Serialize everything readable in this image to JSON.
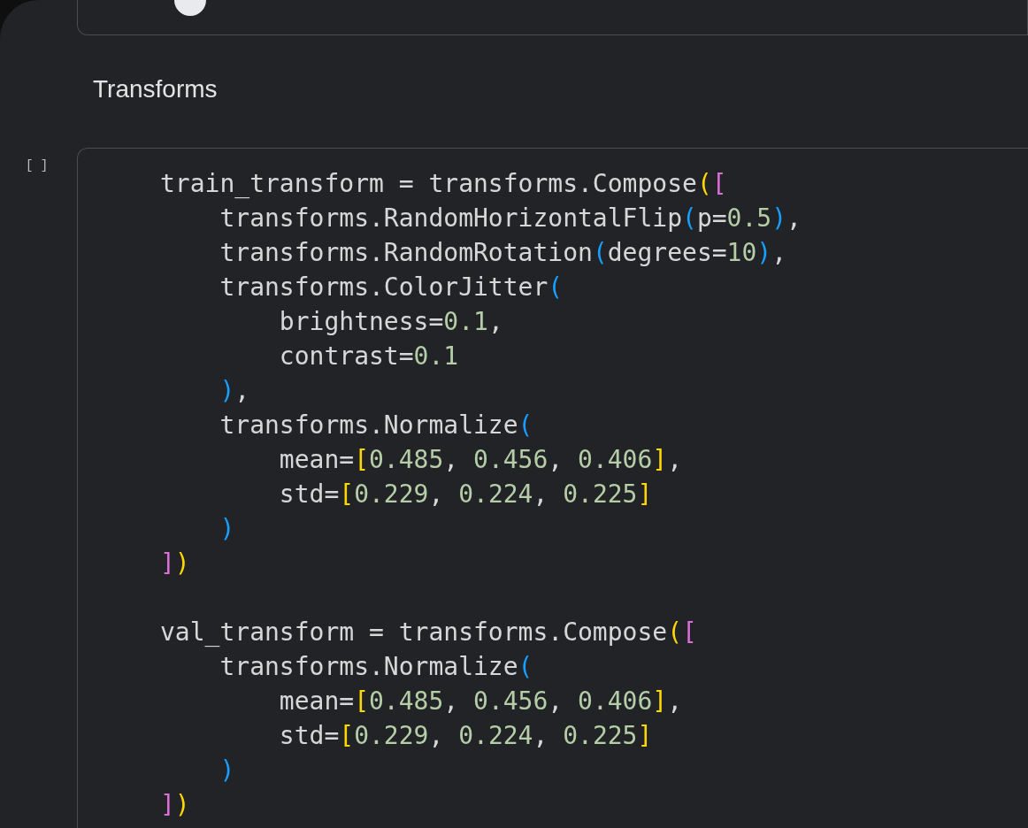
{
  "text_cell": {
    "heading": "Transforms"
  },
  "code_cell": {
    "execution_count": "[ ]",
    "statements": [
      [
        [
          {
            "kind": "plain",
            "text": "train_transform = transforms.Compose"
          },
          {
            "kind": "gold",
            "text": "("
          },
          {
            "kind": "pink",
            "text": "["
          }
        ],
        [
          {
            "kind": "plain",
            "text": "    transforms.RandomHorizontalFlip"
          },
          {
            "kind": "blue",
            "text": "("
          },
          {
            "kind": "plain",
            "text": "p="
          },
          {
            "kind": "number",
            "text": "0.5"
          },
          {
            "kind": "blue",
            "text": ")"
          },
          {
            "kind": "plain",
            "text": ","
          }
        ],
        [
          {
            "kind": "plain",
            "text": "    transforms.RandomRotation"
          },
          {
            "kind": "blue",
            "text": "("
          },
          {
            "kind": "plain",
            "text": "degrees="
          },
          {
            "kind": "number",
            "text": "10"
          },
          {
            "kind": "blue",
            "text": ")"
          },
          {
            "kind": "plain",
            "text": ","
          }
        ],
        [
          {
            "kind": "plain",
            "text": "    transforms.ColorJitter"
          },
          {
            "kind": "blue",
            "text": "("
          }
        ],
        [
          {
            "kind": "plain",
            "text": "        brightness="
          },
          {
            "kind": "number",
            "text": "0.1"
          },
          {
            "kind": "plain",
            "text": ","
          }
        ],
        [
          {
            "kind": "plain",
            "text": "        contrast="
          },
          {
            "kind": "number",
            "text": "0.1"
          }
        ],
        [
          {
            "kind": "blue",
            "text": "    )"
          },
          {
            "kind": "plain",
            "text": ","
          }
        ],
        [
          {
            "kind": "plain",
            "text": "    transforms.Normalize"
          },
          {
            "kind": "blue",
            "text": "("
          }
        ],
        [
          {
            "kind": "plain",
            "text": "        mean="
          },
          {
            "kind": "gold",
            "text": "["
          },
          {
            "kind": "number",
            "text": "0.485"
          },
          {
            "kind": "plain",
            "text": ", "
          },
          {
            "kind": "number",
            "text": "0.456"
          },
          {
            "kind": "plain",
            "text": ", "
          },
          {
            "kind": "number",
            "text": "0.406"
          },
          {
            "kind": "gold",
            "text": "]"
          },
          {
            "kind": "plain",
            "text": ","
          }
        ],
        [
          {
            "kind": "plain",
            "text": "        std="
          },
          {
            "kind": "gold",
            "text": "["
          },
          {
            "kind": "number",
            "text": "0.229"
          },
          {
            "kind": "plain",
            "text": ", "
          },
          {
            "kind": "number",
            "text": "0.224"
          },
          {
            "kind": "plain",
            "text": ", "
          },
          {
            "kind": "number",
            "text": "0.225"
          },
          {
            "kind": "gold",
            "text": "]"
          }
        ],
        [
          {
            "kind": "blue",
            "text": "    )"
          }
        ],
        [
          {
            "kind": "pink",
            "text": "]"
          },
          {
            "kind": "gold",
            "text": ")"
          }
        ]
      ],
      [
        [
          {
            "kind": "plain",
            "text": "val_transform = transforms.Compose"
          },
          {
            "kind": "gold",
            "text": "("
          },
          {
            "kind": "pink",
            "text": "["
          }
        ],
        [
          {
            "kind": "plain",
            "text": "    transforms.Normalize"
          },
          {
            "kind": "blue",
            "text": "("
          }
        ],
        [
          {
            "kind": "plain",
            "text": "        mean="
          },
          {
            "kind": "gold",
            "text": "["
          },
          {
            "kind": "number",
            "text": "0.485"
          },
          {
            "kind": "plain",
            "text": ", "
          },
          {
            "kind": "number",
            "text": "0.456"
          },
          {
            "kind": "plain",
            "text": ", "
          },
          {
            "kind": "number",
            "text": "0.406"
          },
          {
            "kind": "gold",
            "text": "]"
          },
          {
            "kind": "plain",
            "text": ","
          }
        ],
        [
          {
            "kind": "plain",
            "text": "        std="
          },
          {
            "kind": "gold",
            "text": "["
          },
          {
            "kind": "number",
            "text": "0.229"
          },
          {
            "kind": "plain",
            "text": ", "
          },
          {
            "kind": "number",
            "text": "0.224"
          },
          {
            "kind": "plain",
            "text": ", "
          },
          {
            "kind": "number",
            "text": "0.225"
          },
          {
            "kind": "gold",
            "text": "]"
          }
        ],
        [
          {
            "kind": "blue",
            "text": "    )"
          }
        ],
        [
          {
            "kind": "pink",
            "text": "]"
          },
          {
            "kind": "gold",
            "text": ")"
          }
        ]
      ]
    ]
  }
}
